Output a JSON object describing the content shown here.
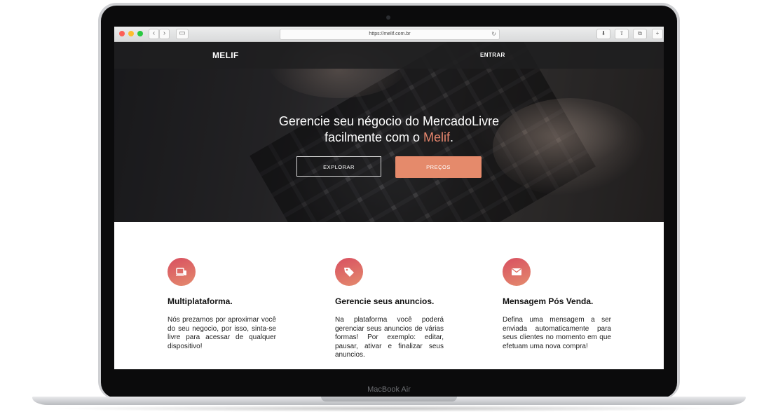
{
  "device": {
    "label": "MacBook Air"
  },
  "browser": {
    "url": "https://melif.com.br"
  },
  "site": {
    "brand": "MELIF",
    "login": "ENTRAR",
    "headline_line1": "Gerencie seu négocio do MercadoLivre",
    "headline_line2_prefix": "facilmente com o ",
    "headline_accent": "Melif",
    "headline_suffix": ".",
    "explore_label": "EXPLORAR",
    "price_label": "PREÇOS",
    "accent_color": "#e58a6b"
  },
  "features": [
    {
      "icon": "devices-icon",
      "title": "Multiplataforma.",
      "text": "Nós prezamos por aproximar você do seu negocio, por isso, sinta-se livre para acessar de qualquer dispositivo!"
    },
    {
      "icon": "tag-icon",
      "title": "Gerencie seus anuncios.",
      "text": "Na plataforma você poderá gerenciar seus anuncios de várias formas! Por exemplo: editar, pausar, ativar e finalizar seus anuncios."
    },
    {
      "icon": "mail-icon",
      "title": "Mensagem Pós Venda.",
      "text": "Defina uma mensagem a ser enviada automaticamente para seus clientes no momento em que efetuam uma nova compra!"
    }
  ]
}
